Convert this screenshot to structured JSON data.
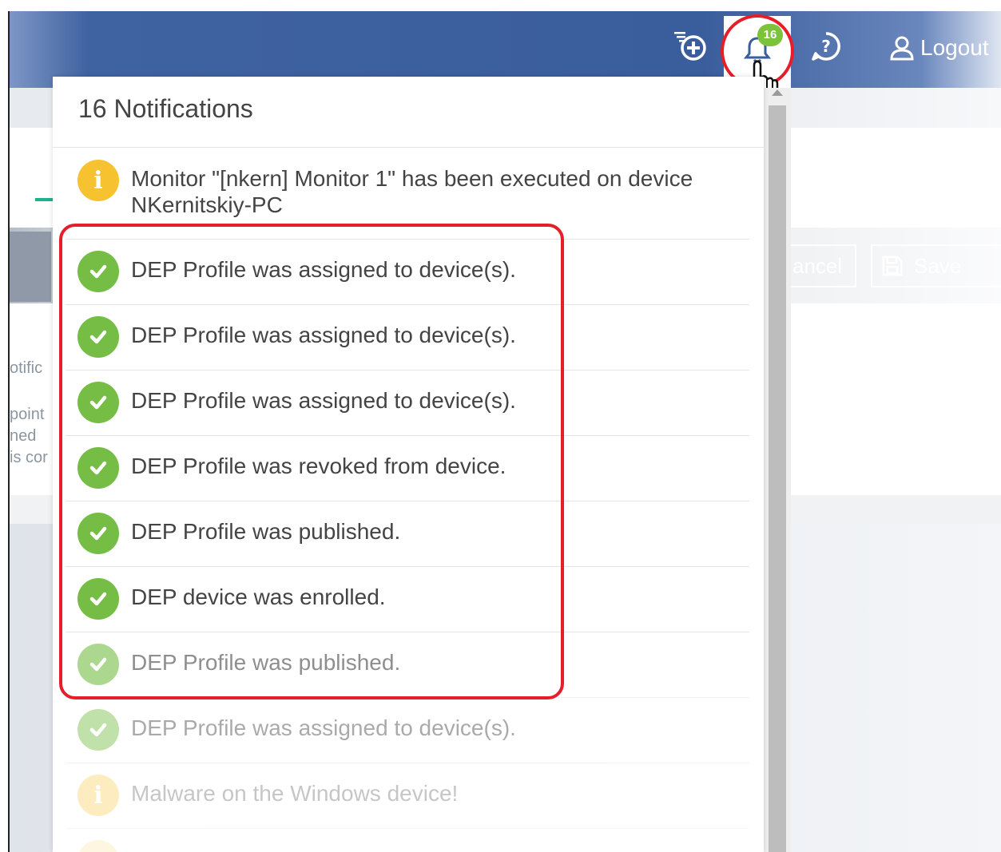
{
  "header": {
    "add_icon": "add-list-icon",
    "bell_icon": "bell-icon",
    "help_icon": "help-icon",
    "badge_count": "16",
    "logout_label": "Logout"
  },
  "background": {
    "cancel_label": "ancel",
    "save_label": "Save",
    "left_texts": [
      "otific",
      "point",
      "ned",
      "is cor"
    ]
  },
  "panel": {
    "title": "16 Notifications",
    "items": [
      {
        "type": "info",
        "text": "Monitor \"[nkern] Monitor 1\" has been executed on device",
        "text2": "NKernitskiy-PC"
      },
      {
        "type": "success",
        "text": "DEP Profile was assigned to device(s)."
      },
      {
        "type": "success",
        "text": "DEP Profile was assigned to device(s)."
      },
      {
        "type": "success",
        "text": "DEP Profile was assigned to device(s)."
      },
      {
        "type": "success",
        "text": "DEP Profile was revoked from device."
      },
      {
        "type": "success",
        "text": "DEP Profile was published."
      },
      {
        "type": "success",
        "text": "DEP device was enrolled."
      },
      {
        "type": "success",
        "text": "DEP Profile was published."
      },
      {
        "type": "success",
        "text": "DEP Profile was assigned to device(s)."
      },
      {
        "type": "info",
        "text": "Malware on the Windows device!"
      }
    ]
  },
  "colors": {
    "header_blue": "#3a5d9c",
    "success_green": "#75bd45",
    "info_yellow": "#f6c22f",
    "highlight_red": "#e61e2a",
    "badge_green": "#7dc23b"
  }
}
